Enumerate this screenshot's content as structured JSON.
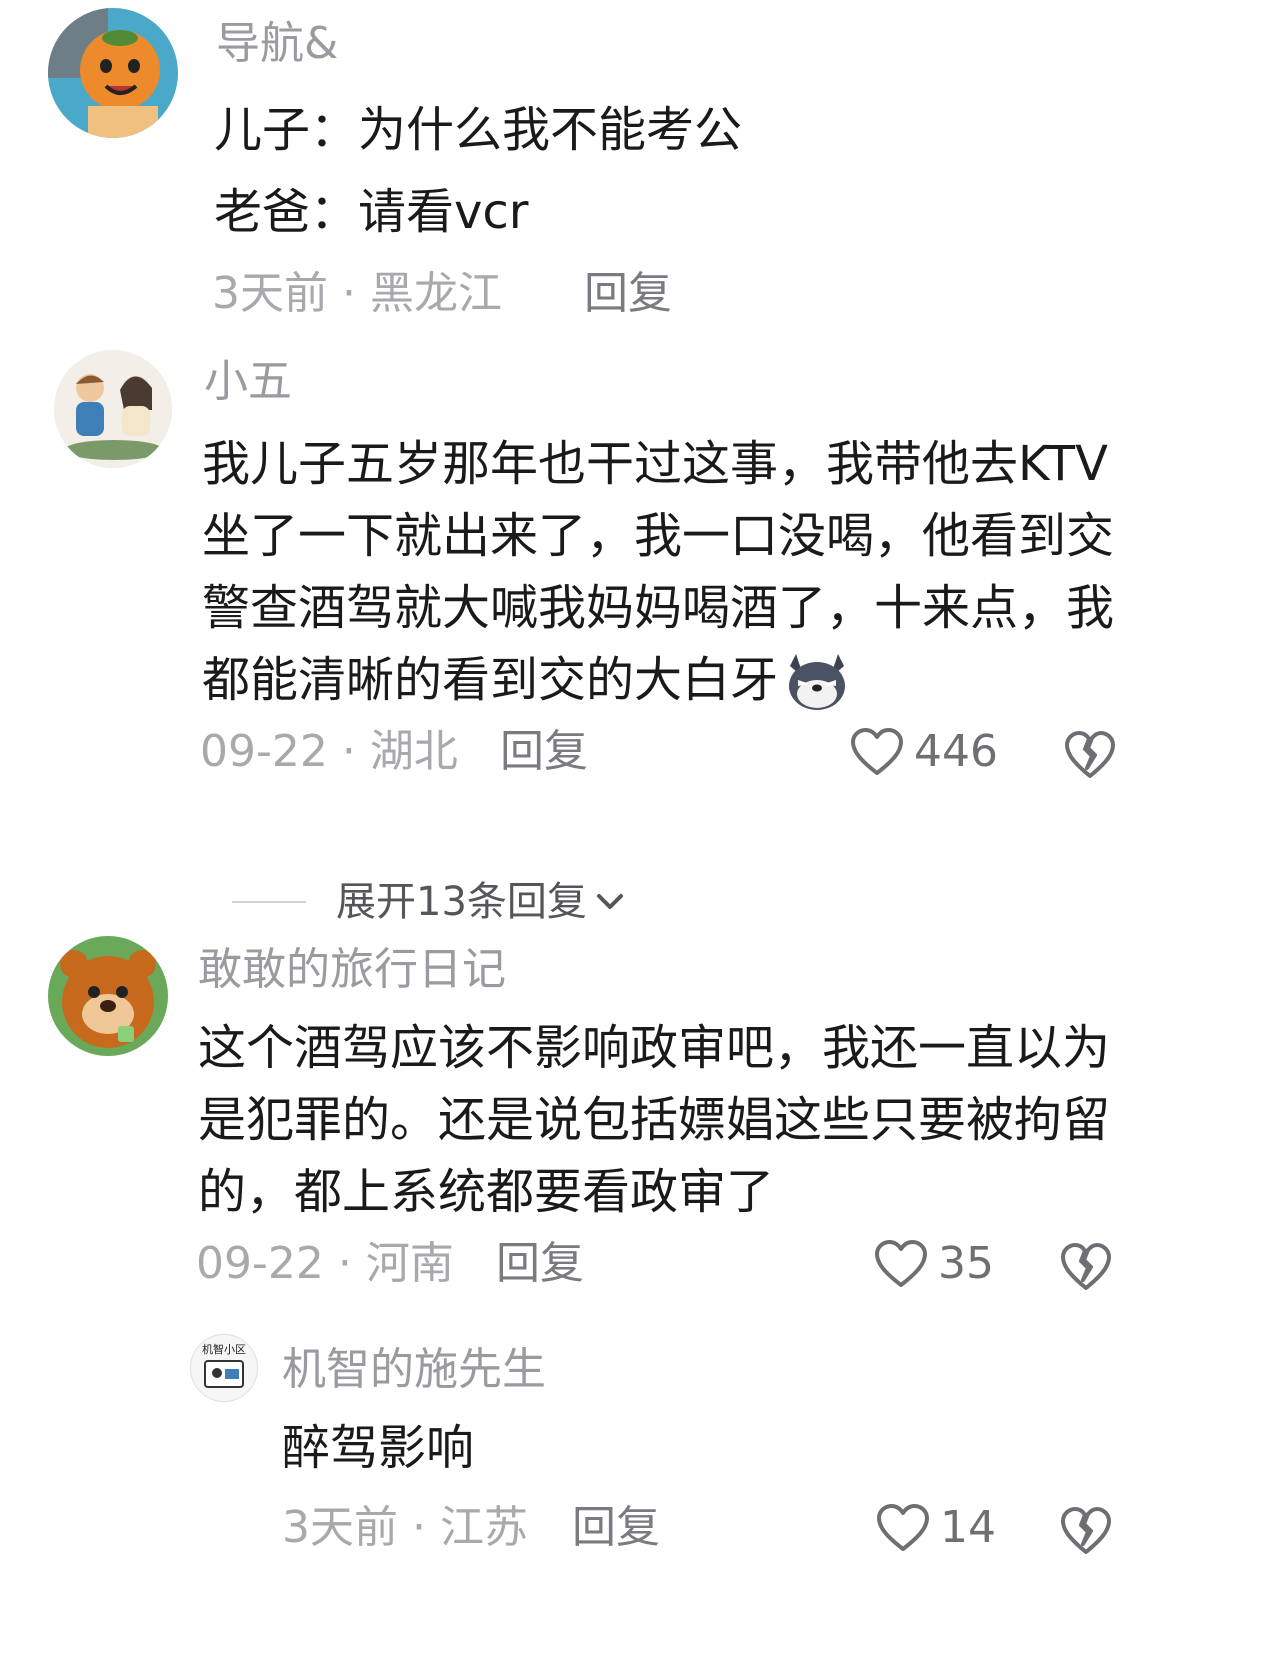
{
  "comments": [
    {
      "username": "导航&",
      "lines": [
        "儿子：为什么我不能考公",
        "老爸：请看vcr"
      ],
      "time": "3天前",
      "location": "黑龙江",
      "reply_label": "回复"
    },
    {
      "username": "小五",
      "lines": [
        "我儿子五岁那年也干过这事，我带他去KTV",
        "坐了一下就出来了，我一口没喝，他看到交",
        "警查酒驾就大喊我妈妈喝酒了，十来点，我",
        "都能清晰的看到交的大白牙"
      ],
      "time": "09-22",
      "location": "湖北",
      "reply_label": "回复",
      "likes": "446",
      "expand_label": "展开13条回复"
    },
    {
      "username": "敢敢的旅行日记",
      "lines": [
        "这个酒驾应该不影响政审吧，我还一直以为",
        "是犯罪的。还是说包括嫖娼这些只要被拘留",
        "的，都上系统都要看政审了"
      ],
      "time": "09-22",
      "location": "河南",
      "reply_label": "回复",
      "likes": "35"
    },
    {
      "username": "机智的施先生",
      "lines": [
        "醉驾影响"
      ],
      "time": "3天前",
      "location": "江苏",
      "reply_label": "回复",
      "likes": "14"
    }
  ],
  "separator": " · ",
  "icons": {
    "like": "heart-outline-icon",
    "dislike": "broken-heart-icon",
    "expand": "chevron-down-icon",
    "emoji": "wolf-emoji-icon"
  },
  "avatar_text": "机智小区"
}
